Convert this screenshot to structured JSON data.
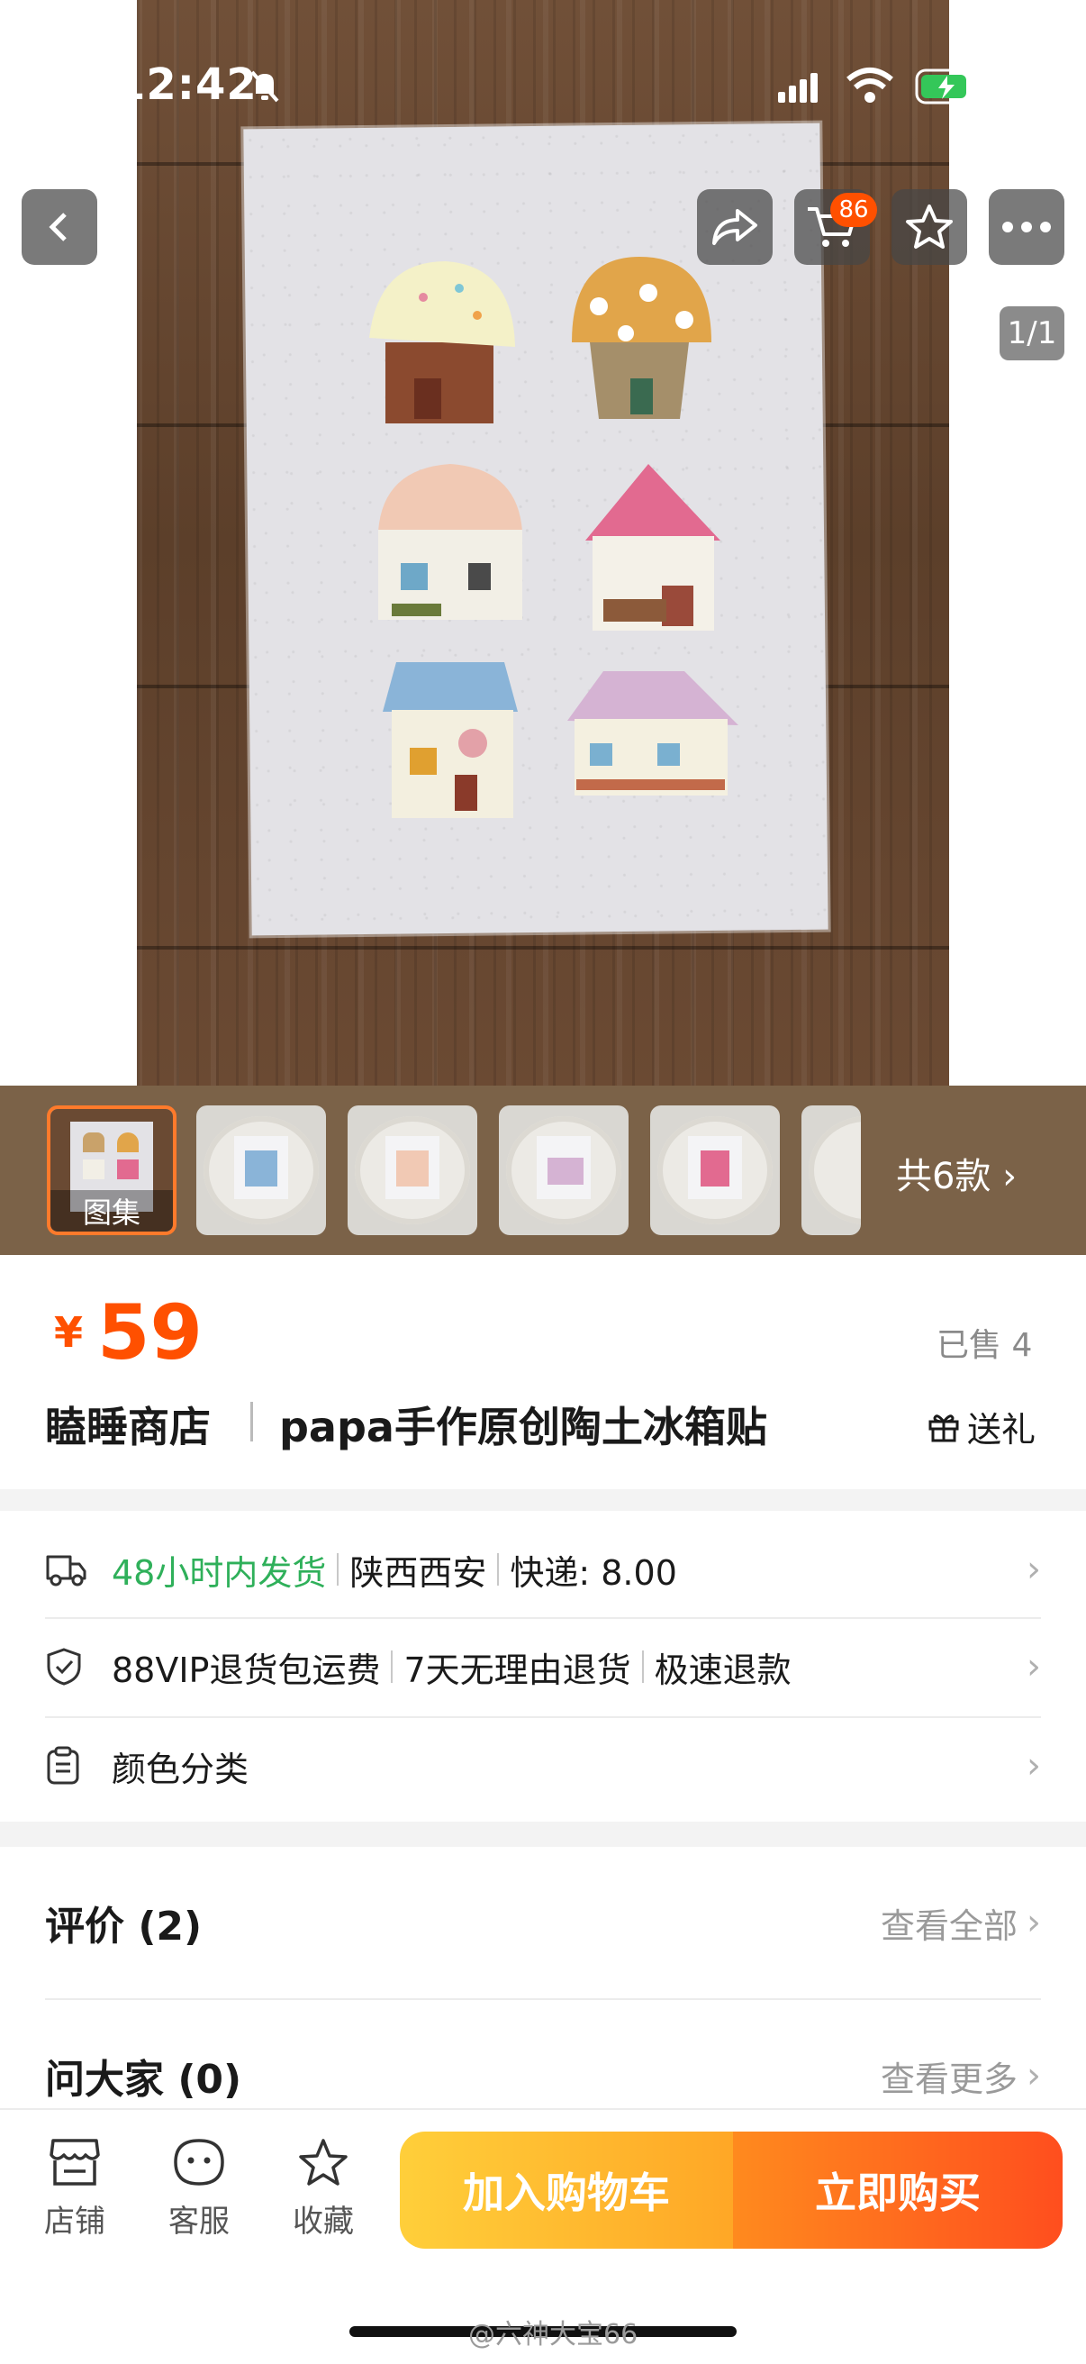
{
  "status": {
    "time": "12:42"
  },
  "hero": {
    "cart_count": "86",
    "counter": "1/1"
  },
  "thumbs": {
    "first_label": "图集",
    "count_label": "共6款"
  },
  "product": {
    "price_symbol": "¥",
    "price": "59",
    "sold": "已售 4",
    "shop_name": "瞌睡商店",
    "title": "papa手作原创陶土冰箱贴",
    "gift": "送礼"
  },
  "service": {
    "shipping_time": "48小时内发货",
    "location": "陕西西安",
    "express": "快递: 8.00",
    "vip": "88VIP退货包运费",
    "return": "7天无理由退货",
    "refund": "极速退款",
    "color": "颜色分类"
  },
  "reviews": {
    "title": "评价 (2)",
    "more": "查看全部"
  },
  "qa": {
    "title": "问大家 (0)",
    "more": "查看更多"
  },
  "bottom": {
    "store": "店铺",
    "service": "客服",
    "favorite": "收藏",
    "add_cart": "加入购物车",
    "buy_now": "立即购买"
  },
  "watermark": "@六神大宝66",
  "colors": {
    "accent": "#ff5000",
    "green": "#2fb05a"
  }
}
